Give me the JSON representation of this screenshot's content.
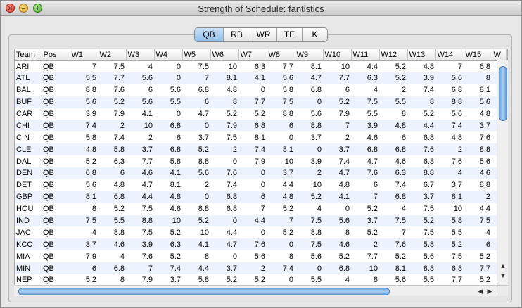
{
  "window": {
    "title": "Strength of Schedule: fantistics"
  },
  "tabs": [
    {
      "label": "QB",
      "active": true
    },
    {
      "label": "RB",
      "active": false
    },
    {
      "label": "WR",
      "active": false
    },
    {
      "label": "TE",
      "active": false
    },
    {
      "label": "K",
      "active": false
    }
  ],
  "table": {
    "columns": [
      "Team",
      "Pos",
      "W1",
      "W2",
      "W3",
      "W4",
      "W5",
      "W6",
      "W7",
      "W8",
      "W9",
      "W10",
      "W11",
      "W12",
      "W13",
      "W14",
      "W15",
      "W"
    ],
    "rows": [
      [
        "ARI",
        "QB",
        "7",
        "7.5",
        "4",
        "0",
        "7.5",
        "10",
        "6.3",
        "7.7",
        "8.1",
        "10",
        "4.4",
        "5.2",
        "4.8",
        "7",
        "6.8"
      ],
      [
        "ATL",
        "QB",
        "5.5",
        "7.7",
        "5.6",
        "0",
        "7",
        "8.1",
        "4.1",
        "5.6",
        "4.7",
        "7.7",
        "6.3",
        "5.2",
        "3.9",
        "5.6",
        "8"
      ],
      [
        "BAL",
        "QB",
        "8.8",
        "7.6",
        "6",
        "5.6",
        "6.8",
        "4.8",
        "0",
        "5.8",
        "6.8",
        "6",
        "4",
        "2",
        "7.4",
        "6.8",
        "8.1"
      ],
      [
        "BUF",
        "QB",
        "5.6",
        "5.2",
        "5.6",
        "5.5",
        "6",
        "8",
        "7.7",
        "7.5",
        "0",
        "5.2",
        "7.5",
        "5.5",
        "8",
        "8.8",
        "5.6"
      ],
      [
        "CAR",
        "QB",
        "3.9",
        "7.9",
        "4.1",
        "0",
        "4.7",
        "5.2",
        "5.2",
        "8.8",
        "5.6",
        "7.9",
        "5.5",
        "8",
        "5.2",
        "5.6",
        "4.8"
      ],
      [
        "CHI",
        "QB",
        "7.4",
        "2",
        "10",
        "6.8",
        "0",
        "7.9",
        "6.8",
        "6",
        "8.8",
        "7",
        "3.9",
        "4.8",
        "4.4",
        "7.4",
        "3.7"
      ],
      [
        "CIN",
        "QB",
        "5.8",
        "7.4",
        "2",
        "6",
        "3.7",
        "7.5",
        "8.1",
        "0",
        "3.7",
        "2",
        "4.6",
        "6",
        "6.8",
        "4.8",
        "7.6"
      ],
      [
        "CLE",
        "QB",
        "4.8",
        "5.8",
        "3.7",
        "6.8",
        "5.2",
        "2",
        "7.4",
        "8.1",
        "0",
        "3.7",
        "6.8",
        "6.8",
        "7.6",
        "2",
        "8.8"
      ],
      [
        "DAL",
        "QB",
        "5.2",
        "6.3",
        "7.7",
        "5.8",
        "8.8",
        "0",
        "7.9",
        "10",
        "3.9",
        "7.4",
        "4.7",
        "4.6",
        "6.3",
        "7.6",
        "5.6"
      ],
      [
        "DEN",
        "QB",
        "6.8",
        "6",
        "4.6",
        "4.1",
        "5.6",
        "7.6",
        "0",
        "3.7",
        "2",
        "4.7",
        "7.6",
        "6.3",
        "8.8",
        "4",
        "4.6"
      ],
      [
        "DET",
        "QB",
        "5.6",
        "4.8",
        "4.7",
        "8.1",
        "2",
        "7.4",
        "0",
        "4.4",
        "10",
        "4.8",
        "6",
        "7.4",
        "6.7",
        "3.7",
        "8.8"
      ],
      [
        "GBP",
        "QB",
        "8.1",
        "6.8",
        "4.4",
        "4.8",
        "0",
        "6.8",
        "6",
        "4.8",
        "5.2",
        "4.1",
        "7",
        "6.8",
        "3.7",
        "8.1",
        "2"
      ],
      [
        "HOU",
        "QB",
        "8",
        "5.2",
        "7.5",
        "4.6",
        "8.8",
        "6.8",
        "7",
        "5.2",
        "4",
        "0",
        "5.2",
        "4",
        "7.5",
        "10",
        "4.4"
      ],
      [
        "IND",
        "QB",
        "7.5",
        "5.5",
        "8.8",
        "10",
        "5.2",
        "0",
        "4.4",
        "7",
        "7.5",
        "5.6",
        "3.7",
        "7.5",
        "5.2",
        "5.8",
        "7.5"
      ],
      [
        "JAC",
        "QB",
        "4",
        "8.8",
        "7.5",
        "5.2",
        "10",
        "4.4",
        "0",
        "5.2",
        "8.8",
        "8",
        "5.2",
        "7",
        "7.5",
        "5.5",
        "4"
      ],
      [
        "KCC",
        "QB",
        "3.7",
        "4.6",
        "3.9",
        "6.3",
        "4.1",
        "4.7",
        "7.6",
        "0",
        "7.5",
        "4.6",
        "2",
        "7.6",
        "5.8",
        "5.2",
        "6"
      ],
      [
        "MIA",
        "QB",
        "7.9",
        "4",
        "7.6",
        "5.2",
        "8",
        "0",
        "5.6",
        "8",
        "5.6",
        "5.2",
        "7.7",
        "5.2",
        "5.6",
        "7.5",
        "5.2"
      ],
      [
        "MIN",
        "QB",
        "6",
        "6.8",
        "7",
        "7.4",
        "4.4",
        "3.7",
        "2",
        "7.4",
        "0",
        "6.8",
        "10",
        "8.1",
        "8.8",
        "6.8",
        "7.7"
      ],
      [
        "NEP",
        "QB",
        "5.2",
        "8",
        "7.9",
        "3.7",
        "5.8",
        "5.2",
        "5.2",
        "0",
        "5.5",
        "4",
        "8",
        "5.6",
        "5.5",
        "7.7",
        "5.2"
      ]
    ]
  },
  "icons": {
    "close": "close-icon",
    "minimize": "minimize-icon",
    "zoom": "zoom-icon",
    "scroll_up": "arrow-up-icon",
    "scroll_down": "arrow-down-icon",
    "scroll_left": "arrow-left-icon",
    "scroll_right": "arrow-right-icon"
  },
  "colors": {
    "row_alt": "#edf3fe",
    "tab_active": "#8fbde9",
    "scroll_thumb": "#6aa3dc"
  }
}
